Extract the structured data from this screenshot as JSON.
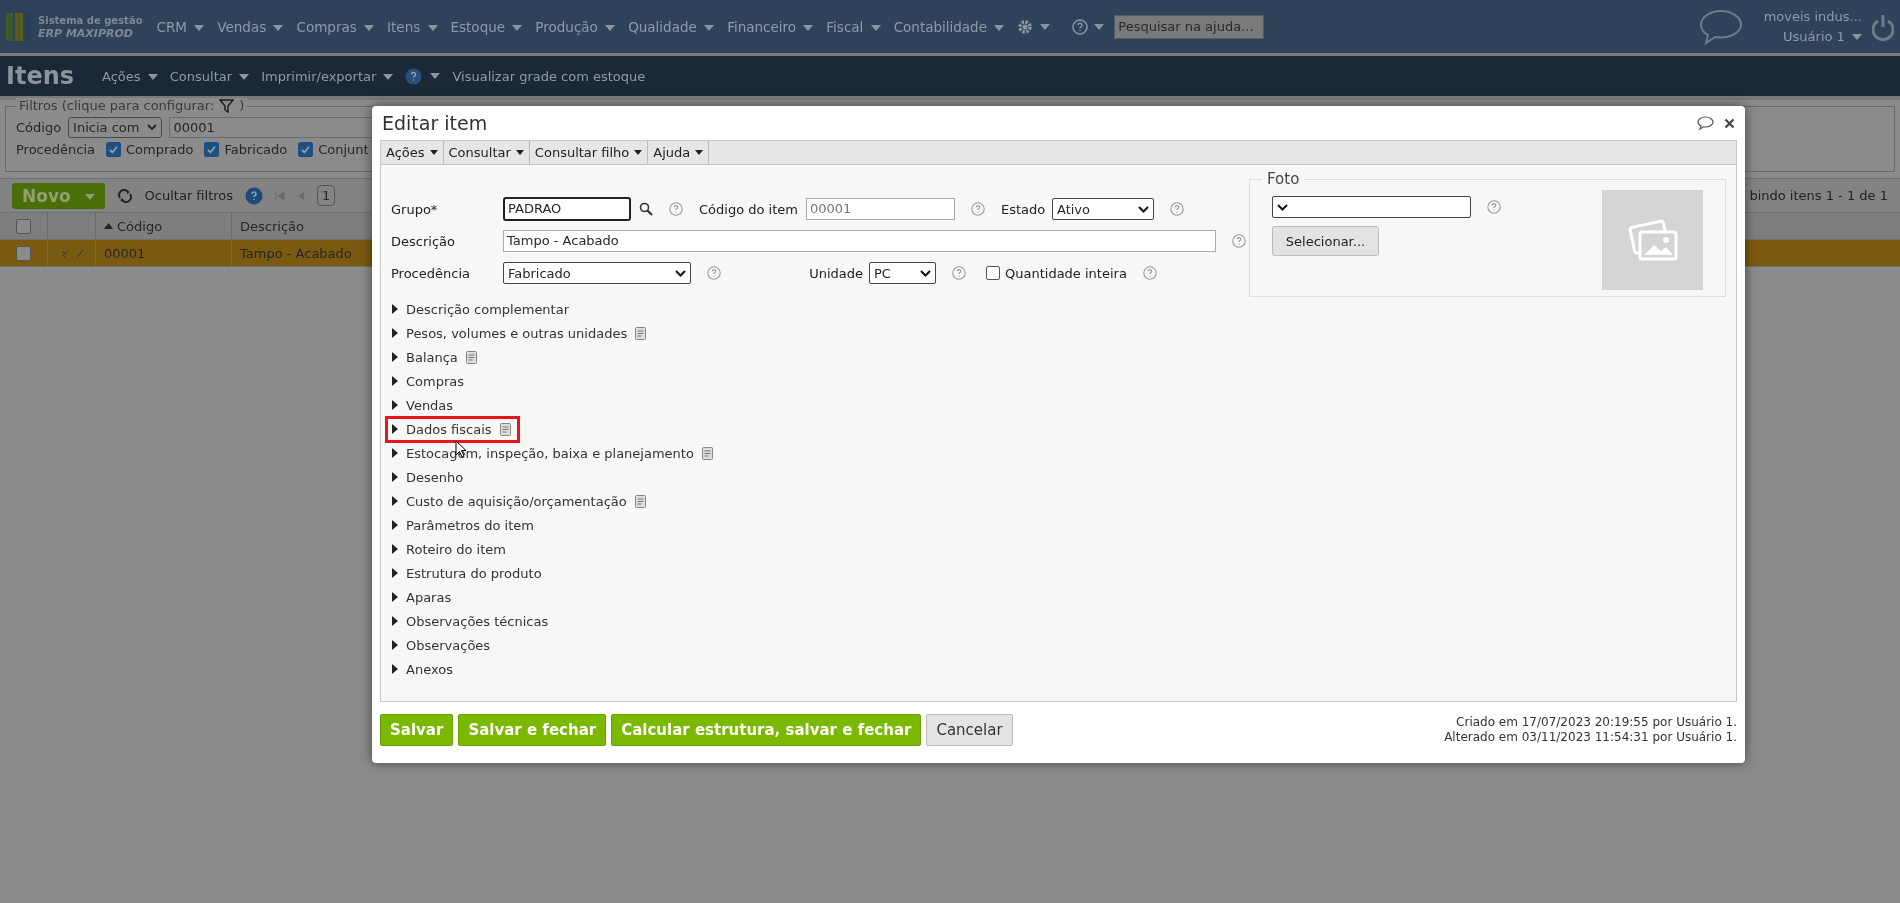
{
  "app": {
    "logo_line1": "Sistema de gestão",
    "logo_line2": "ERP MAXIPROD"
  },
  "top_menu": [
    "CRM",
    "Vendas",
    "Compras",
    "Itens",
    "Estoque",
    "Produção",
    "Qualidade",
    "Financeiro",
    "Fiscal",
    "Contabilidade"
  ],
  "help_search": {
    "placeholder": "Pesquisar na ajuda..."
  },
  "user": {
    "company": "moveis indus...",
    "name": "Usuário 1"
  },
  "page": {
    "title": "Itens",
    "menu": [
      "Ações",
      "Consultar",
      "Imprimir/exportar"
    ],
    "link": "Visualizar grade com estoque"
  },
  "filters": {
    "legend": "Filtros (clique para configurar:",
    "legend_end": ")",
    "code_label": "Código",
    "code_operator": "Inicia com",
    "code_value": "00001",
    "origin_label": "Procedência",
    "options": [
      {
        "label": "Comprado",
        "checked": true
      },
      {
        "label": "Fabricado",
        "checked": true
      },
      {
        "label": "Conjunt",
        "checked": true
      }
    ]
  },
  "toolbar": {
    "new_button": "Novo",
    "toggle_filters": "Ocultar filtros",
    "page": "1",
    "summary": "bindo itens 1 - 1 de 1"
  },
  "table": {
    "all_checked": false,
    "columns": [
      "Código",
      "Descrição"
    ],
    "rows": [
      {
        "cells": [
          "00001",
          "Tampo - Acabado"
        ],
        "selected": true,
        "checked": false
      }
    ]
  },
  "dialog": {
    "title": "Editar item",
    "menu": [
      "Ações",
      "Consultar",
      "Consultar filho",
      "Ajuda"
    ],
    "group": {
      "label": "Grupo*",
      "value": "PADRAO"
    },
    "code": {
      "label": "Código do item",
      "value": "00001",
      "readonly": true
    },
    "state": {
      "label": "Estado",
      "value": "Ativo"
    },
    "description": {
      "label": "Descrição",
      "value": "Tampo - Acabado"
    },
    "origin": {
      "label": "Procedência",
      "value": "Fabricado"
    },
    "unit": {
      "label": "Unidade",
      "value": "PC"
    },
    "integer_quantity": {
      "label": "Quantidade inteira",
      "checked": false
    },
    "photo": {
      "legend": "Foto",
      "button": "Selecionar..."
    },
    "sections": [
      {
        "label": "Descrição complementar",
        "note": false,
        "highlighted": false
      },
      {
        "label": "Pesos, volumes e outras unidades",
        "note": true,
        "highlighted": false
      },
      {
        "label": "Balança",
        "note": true,
        "highlighted": false
      },
      {
        "label": "Compras",
        "note": false,
        "highlighted": false
      },
      {
        "label": "Vendas",
        "note": false,
        "highlighted": false
      },
      {
        "label": "Dados fiscais",
        "note": true,
        "highlighted": true
      },
      {
        "label": "Estocagem, inspeção, baixa e planejamento",
        "note": true,
        "highlighted": false
      },
      {
        "label": "Desenho",
        "note": false,
        "highlighted": false
      },
      {
        "label": "Custo de aquisição/orçamentação",
        "note": true,
        "highlighted": false
      },
      {
        "label": "Parâmetros do item",
        "note": false,
        "highlighted": false
      },
      {
        "label": "Roteiro do item",
        "note": false,
        "highlighted": false
      },
      {
        "label": "Estrutura do produto",
        "note": false,
        "highlighted": false
      },
      {
        "label": "Aparas",
        "note": false,
        "highlighted": false
      },
      {
        "label": "Observações técnicas",
        "note": false,
        "highlighted": false
      },
      {
        "label": "Observações",
        "note": false,
        "highlighted": false
      },
      {
        "label": "Anexos",
        "note": false,
        "highlighted": false
      }
    ],
    "buttons": [
      {
        "label": "Salvar",
        "kind": "primary"
      },
      {
        "label": "Salvar e fechar",
        "kind": "primary"
      },
      {
        "label": "Calcular estrutura, salvar e fechar",
        "kind": "primary"
      },
      {
        "label": "Cancelar",
        "kind": "secondary"
      }
    ],
    "audit": [
      "Criado em 17/07/2023 20:19:55 por Usuário 1.",
      "Alterado em 03/11/2023 11:54:31 por Usuário 1."
    ]
  }
}
